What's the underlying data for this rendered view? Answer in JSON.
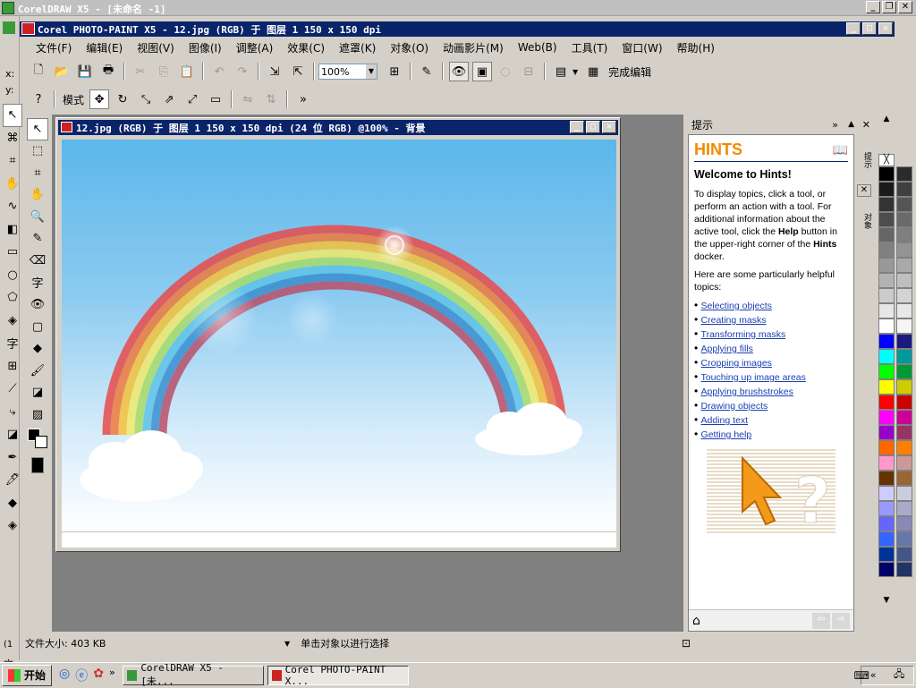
{
  "outer_window": {
    "title": "CorelDRAW X5 - [未命名 -1]"
  },
  "app_window": {
    "title": "Corel PHOTO-PAINT X5 - 12.jpg (RGB) 于 图层 1 150 x 150 dpi"
  },
  "menu": [
    "文件(F)",
    "编辑(E)",
    "视图(V)",
    "图像(I)",
    "调整(A)",
    "效果(C)",
    "遮罩(K)",
    "对象(O)",
    "动画影片(M)",
    "Web(B)",
    "工具(T)",
    "窗口(W)",
    "帮助(H)"
  ],
  "toolbar": {
    "zoom_value": "100%",
    "finish_edit_label": "完成编辑"
  },
  "property_bar": {
    "mode_label": "模式"
  },
  "image_window": {
    "title": "12.jpg (RGB) 于 图层 1 150 x 150 dpi (24 位 RGB) @100% - 背景"
  },
  "hints_docker": {
    "tab_title": "提示",
    "header": "HINTS",
    "welcome": "Welcome to Hints!",
    "intro_1": "To display topics, click a tool, or perform an action with a tool. For additional information about the active tool, click the",
    "intro_bold_help": "Help",
    "intro_2": "button in the upper-right corner of the",
    "intro_bold_hints": "Hints",
    "intro_3": "docker.",
    "topics_intro": "Here are some particularly helpful topics:",
    "topics": [
      "Selecting objects",
      "Creating masks",
      "Transforming masks",
      "Applying fills",
      "Cropping images",
      "Touching up image areas",
      "Applying brushstrokes",
      "Drawing objects",
      "Adding text",
      "Getting help"
    ],
    "side_tabs": [
      "提示",
      "对象"
    ]
  },
  "status_bar": {
    "file_size": "文件大小: 403 KB",
    "hint": "单击对象以进行选择"
  },
  "left_edge": {
    "text_1": "x:",
    "text_2": "y:",
    "text_3": "(1",
    "text_4": "文"
  },
  "taskbar": {
    "start_label": "开始",
    "tasks": [
      "CorelDRAW X5 - [未...",
      "Corel PHOTO-PAINT X..."
    ]
  },
  "palette_colors": [
    "#000000",
    "#1a1a1a",
    "#333333",
    "#4d4d4d",
    "#666666",
    "#808080",
    "#999999",
    "#b3b3b3",
    "#cccccc",
    "#e6e6e6",
    "#ffffff",
    "#0000ff",
    "#00ffff",
    "#00ff00",
    "#ffff00",
    "#ff0000",
    "#ff00ff",
    "#9900cc",
    "#ff6600",
    "#ff99cc",
    "#663300",
    "#ccccff",
    "#9999ff",
    "#6666ff",
    "#3366ff",
    "#003399",
    "#000066"
  ],
  "palette_colors_2": [
    "#2b2b2b",
    "#404040",
    "#555555",
    "#6a6a6a",
    "#7f7f7f",
    "#949494",
    "#a9a9a9",
    "#bebebe",
    "#d3d3d3",
    "#e8e8e8",
    "#f5f5f5",
    "#1a1a80",
    "#009999",
    "#009933",
    "#cccc00",
    "#cc0000",
    "#cc0099",
    "#993366",
    "#ff8000",
    "#cc9999",
    "#996633",
    "#ccccdd",
    "#aaaacc",
    "#8888bb",
    "#6677aa",
    "#445588",
    "#223366"
  ]
}
